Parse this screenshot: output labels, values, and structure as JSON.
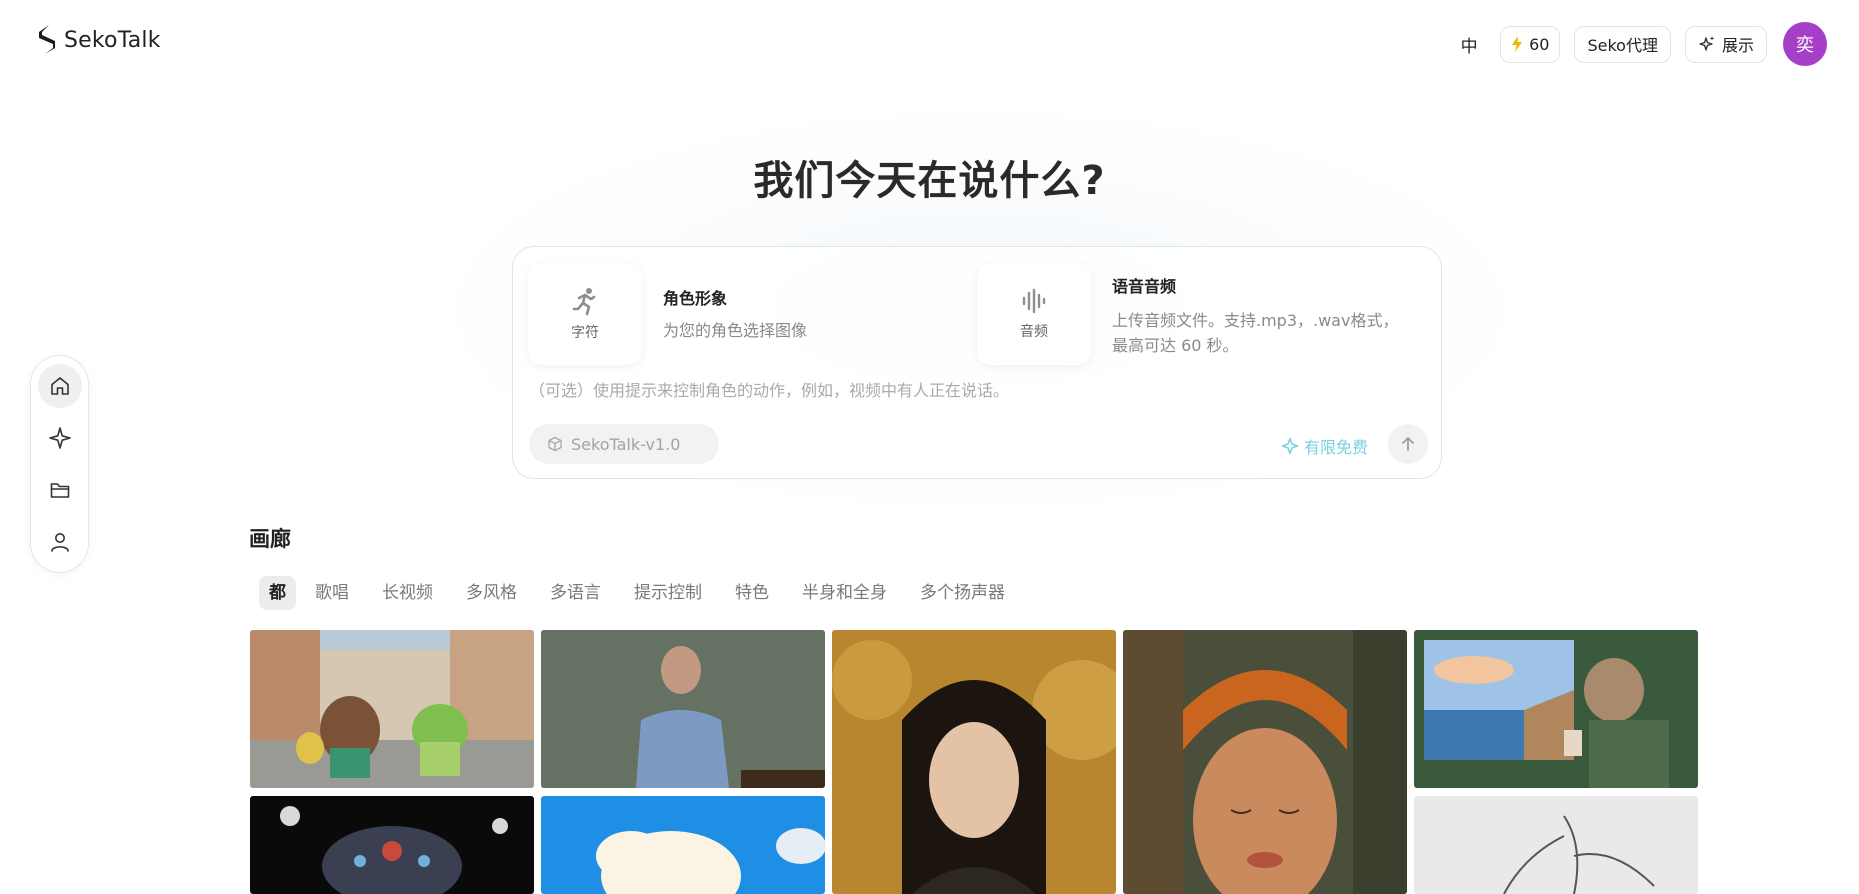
{
  "header": {
    "brand": "SekoTalk",
    "lang_label": "中",
    "credits": "60",
    "agent_label": "Seko代理",
    "showcase_label": "展示",
    "avatar_letter": "奕"
  },
  "rail": {
    "items": [
      {
        "icon": "home-icon",
        "active": true
      },
      {
        "icon": "sparkle-icon",
        "active": false
      },
      {
        "icon": "folder-icon",
        "active": false
      },
      {
        "icon": "user-icon",
        "active": false
      }
    ]
  },
  "hero": {
    "title": "我们今天在说什么?"
  },
  "composer": {
    "character": {
      "tile_label": "字符",
      "title": "角色形象",
      "description": "为您的角色选择图像"
    },
    "audio": {
      "tile_label": "音频",
      "title": "语音音频",
      "description_line1": "上传音频文件。支持.mp3，.wav格式，",
      "description_line2": "最高可达 60 秒。"
    },
    "prompt_placeholder": "（可选）使用提示来控制角色的动作，例如，视频中有人正在说话。",
    "model": "SekoTalk-v1.0",
    "free_label": "有限免费"
  },
  "gallery": {
    "title": "画廊",
    "filters": [
      "都",
      "歌唱",
      "长视频",
      "多风格",
      "多语言",
      "提示控制",
      "特色",
      "半身和全身",
      "多个扬声器"
    ],
    "active_filter": "都"
  },
  "colors": {
    "avatar": "#a63fc8",
    "free_accent": "#79cfe3",
    "credit_bolt": "#f5b400"
  }
}
